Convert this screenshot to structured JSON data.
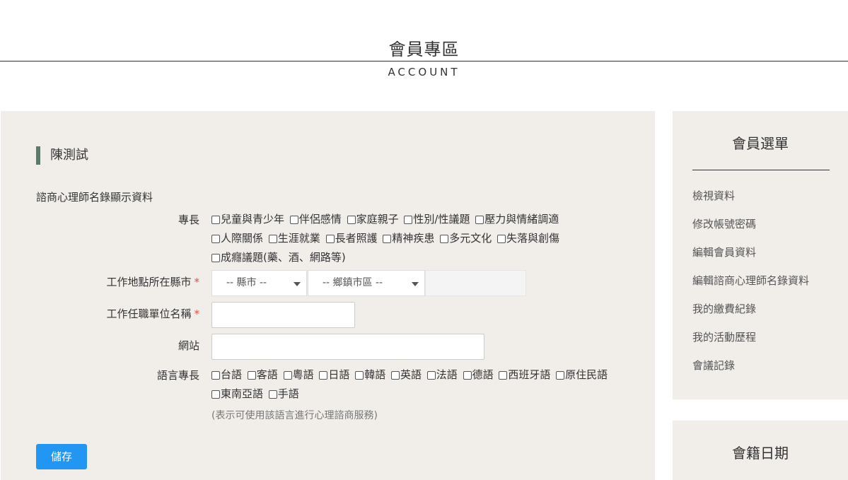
{
  "header": {
    "title": "會員專區",
    "subtitle": "ACCOUNT"
  },
  "main": {
    "user_name": "陳測試",
    "section_title": "諮商心理師名錄顯示資料",
    "specialty": {
      "label": "專長",
      "lines": [
        [
          "兒童與青少年",
          "伴侶感情",
          "家庭親子",
          "性別/性議題",
          "壓力與情緒調適"
        ],
        [
          "人際關係",
          "生涯就業",
          "長者照護",
          "精神疾患",
          "多元文化",
          "失落與創傷"
        ],
        [
          "成癮議題(藥、酒、網路等)"
        ]
      ]
    },
    "work_location": {
      "label": "工作地點所在縣市",
      "required_mark": "*",
      "city_select": "-- 縣市 --",
      "district_select": "-- 鄉鎮市區 --"
    },
    "work_unit": {
      "label": "工作任職單位名稱",
      "required_mark": "*",
      "value": ""
    },
    "website": {
      "label": "網站",
      "value": ""
    },
    "language": {
      "label": "語言專長",
      "lines": [
        [
          "台語",
          "客語",
          "粵語",
          "日語",
          "韓語",
          "英語",
          "法語",
          "德語",
          "西班牙語",
          "原住民語"
        ],
        [
          "東南亞語",
          "手語"
        ]
      ],
      "note": "(表示可使用該語言進行心理諮商服務)"
    },
    "save_label": "儲存"
  },
  "sidebar": {
    "title": "會員選單",
    "items": [
      "檢視資料",
      "修改帳號密碼",
      "編輯會員資料",
      "編輯諮商心理師名錄資料",
      "我的繳費紀錄",
      "我的活動歷程",
      "會議記錄"
    ],
    "second_title": "會籍日期"
  }
}
